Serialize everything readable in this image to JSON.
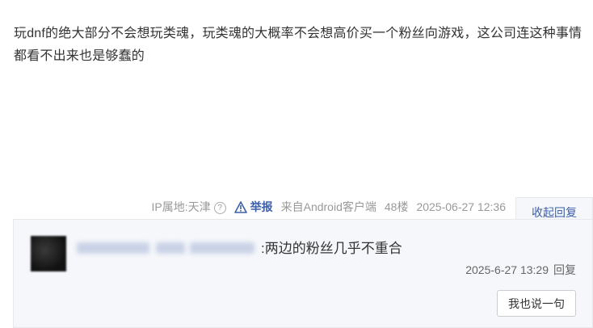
{
  "post": {
    "content": "玩dnf的绝大部分不会想玩类魂，玩类魂的大概率不会想高价买一个粉丝向游戏，这公司连这种事情都看不出来也是够蠢的"
  },
  "meta": {
    "ip": "IP属地:天津",
    "ip_help": "?",
    "report": "举报",
    "client": "来自Android客户端",
    "floor": "48楼",
    "time": "2025-06-27 12:36",
    "collapse_reply": "收起回复"
  },
  "reply": {
    "text": ":两边的粉丝几乎不重合",
    "time": "2025-6-27 13:29",
    "reply_label": "回复"
  },
  "composer": {
    "say_button": "我也说一句"
  },
  "colors": {
    "link": "#3c5fa8",
    "muted": "#999999",
    "reply_bg": "#f5f7fa"
  }
}
